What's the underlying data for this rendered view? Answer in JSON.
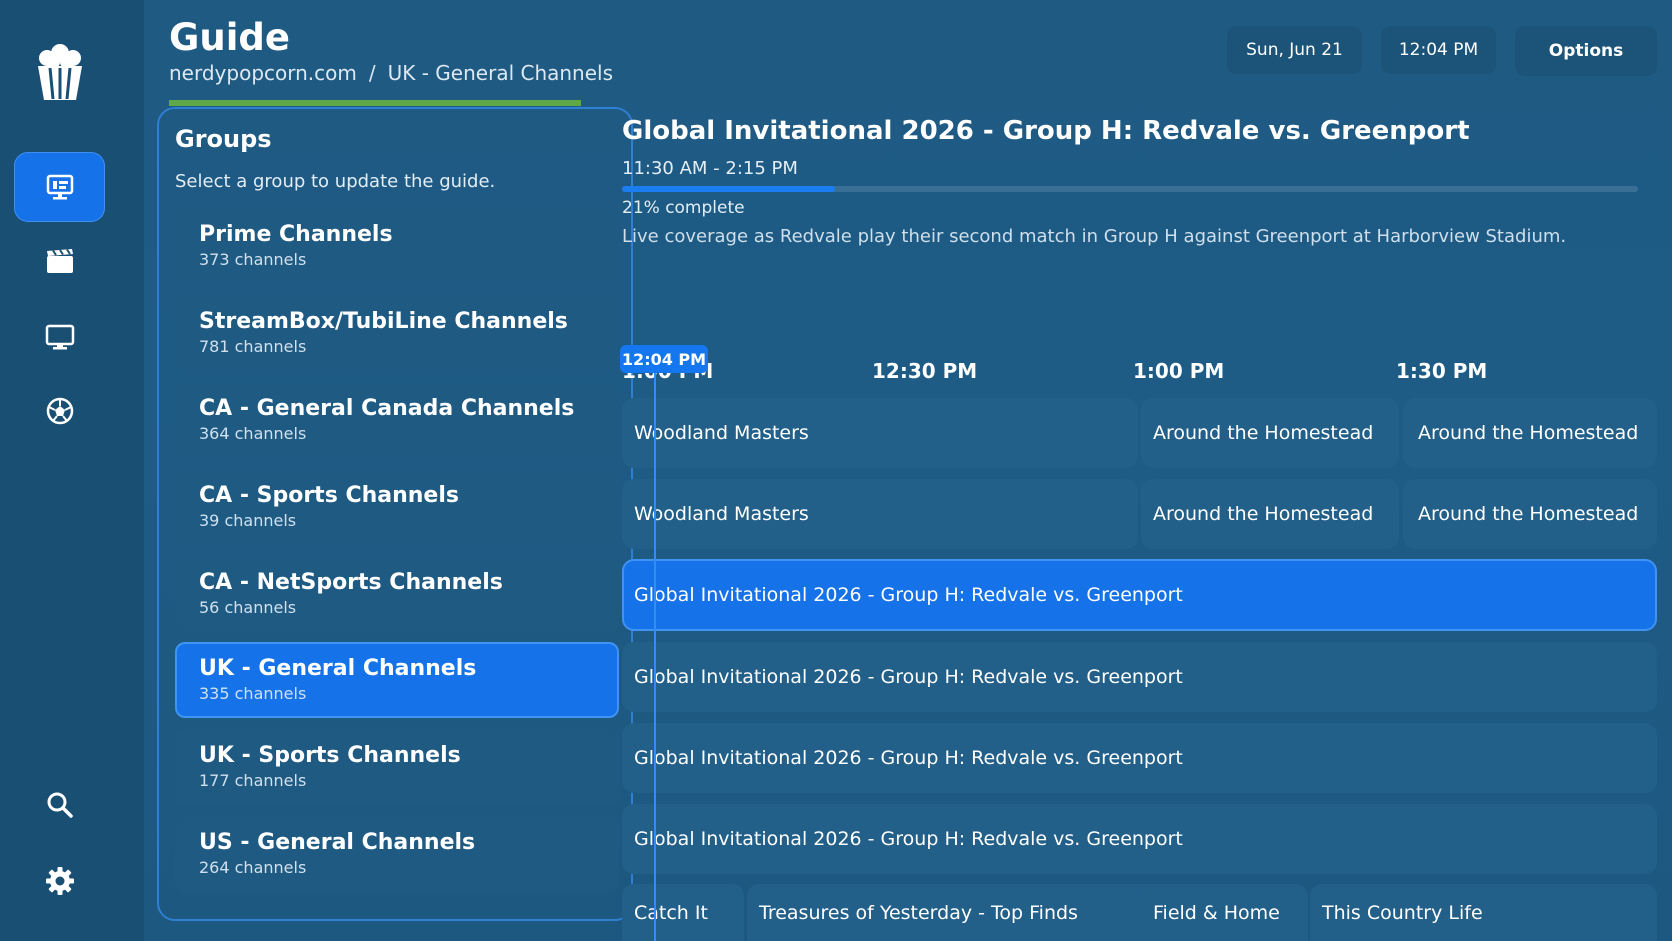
{
  "header": {
    "title": "Guide",
    "breadcrumb": {
      "provider": "nerdypopcorn.com",
      "separator": "/",
      "current": "UK - General Channels"
    },
    "date": "Sun, Jun 21",
    "time": "12:04 PM",
    "options_label": "Options"
  },
  "nav": {
    "items": [
      {
        "icon": "live-tv-icon",
        "active": true
      },
      {
        "icon": "movies-icon",
        "active": false
      },
      {
        "icon": "series-tv-icon",
        "active": false
      },
      {
        "icon": "sports-ball-icon",
        "active": false
      },
      {
        "icon": "search-icon",
        "active": false
      },
      {
        "icon": "gear-icon",
        "active": false
      }
    ],
    "logo": "popcorn-logo-icon"
  },
  "groups": {
    "title": "Groups",
    "subtitle": "Select a group to update the guide.",
    "items": [
      {
        "name": "Prime Channels",
        "count": "373 channels"
      },
      {
        "name": "StreamBox/TubiLine Channels",
        "count": "781 channels"
      },
      {
        "name": "CA - General Canada Channels",
        "count": "364 channels"
      },
      {
        "name": "CA - Sports Channels",
        "count": "39 channels"
      },
      {
        "name": "CA - NetSports Channels",
        "count": "56 channels"
      },
      {
        "name": "UK - General Channels",
        "count": "335 channels",
        "active": true
      },
      {
        "name": "UK - Sports Channels",
        "count": "177 channels"
      },
      {
        "name": "US - General Channels",
        "count": "264 channels"
      }
    ]
  },
  "program": {
    "title": "Global Invitational 2026 - Group H: Redvale vs. Greenport",
    "time": "11:30 AM - 2:15 PM",
    "progress": 0.21,
    "progress_label": "21% complete",
    "description": "Live coverage as Redvale play their second match in Group H against Greenport at Harborview Stadium."
  },
  "timeline": {
    "now_label": "12:04 PM",
    "slots": [
      "1:00 PM",
      "12:30 PM",
      "1:00 PM",
      "1:30 PM"
    ]
  },
  "grid": {
    "rows": [
      [
        "Woodland Masters",
        "Around the Homestead",
        "Around the Homestead"
      ],
      [
        "Woodland Masters",
        "Around the Homestead",
        "Around the Homestead"
      ],
      [
        "Global Invitational 2026 - Group H: Redvale vs. Greenport"
      ],
      [
        "Global Invitational 2026 - Group H: Redvale vs. Greenport"
      ],
      [
        "Global Invitational 2026 - Group H: Redvale vs. Greenport"
      ],
      [
        "Global Invitational 2026 - Group H: Redvale vs. Greenport"
      ],
      [
        "Catch It",
        "Treasures of Yesterday - Top Finds",
        "Field & Home",
        "This Country Life"
      ]
    ]
  },
  "colors": {
    "accent": "#1572e8",
    "background": "#1f5a82",
    "rail": "#1a4f74"
  }
}
